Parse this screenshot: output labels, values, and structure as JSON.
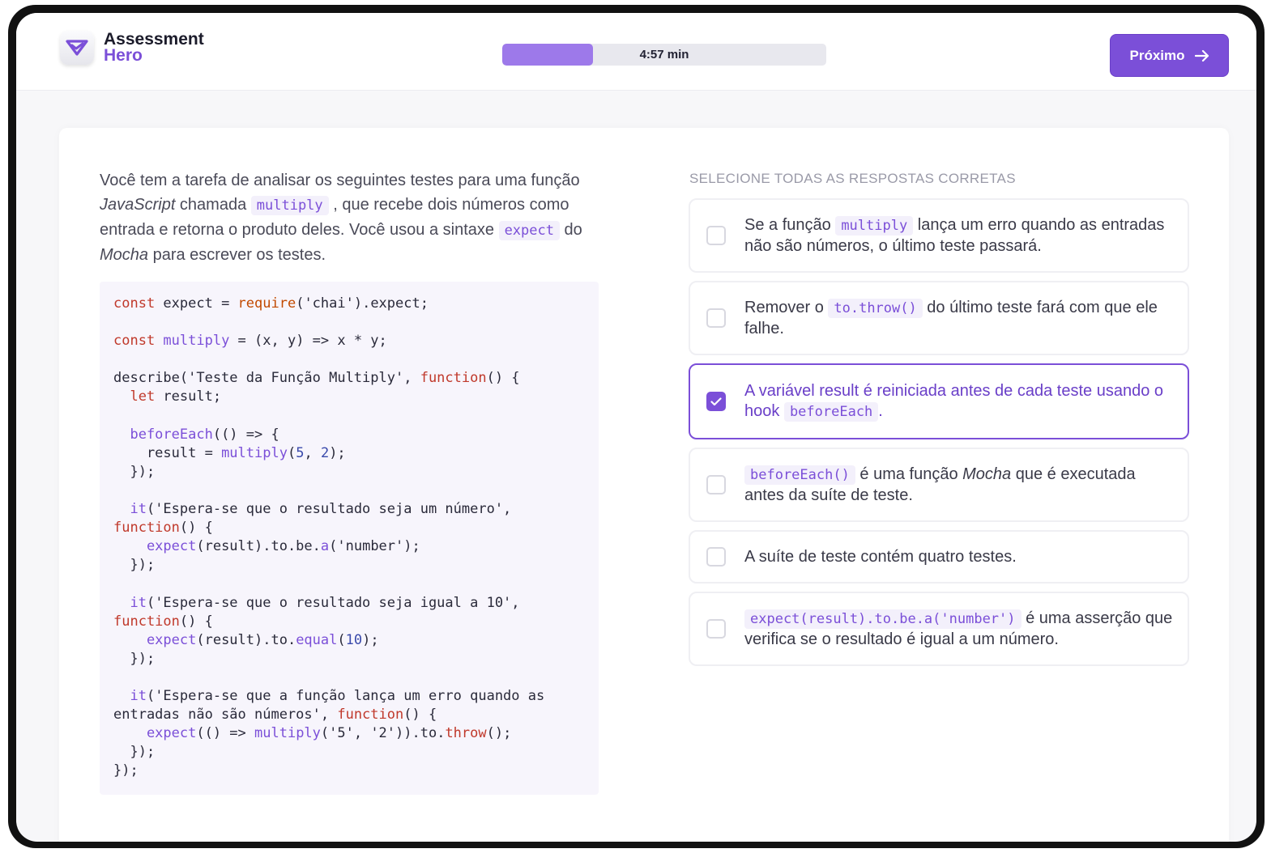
{
  "brand": {
    "line1": "Assessment",
    "line2": "Hero",
    "accent": "#7b4fd8"
  },
  "timer": {
    "label": "4:57 min",
    "progress_fraction": 0.28
  },
  "nav": {
    "next_label": "Próximo"
  },
  "question": {
    "p1": "Você tem a tarefa de analisar os seguintes testes para uma função ",
    "p2": "JavaScript",
    "p3": " chamada ",
    "p4": "multiply",
    "p5": " , que recebe dois números como entrada e retorna o produto deles. Você usou a sintaxe ",
    "p6": "expect",
    "p7": " do ",
    "p8": "Mocha",
    "p9": " para escrever os testes."
  },
  "code": {
    "l1_kw": "const",
    "l1_a": " expect = ",
    "l1_fn": "require",
    "l1_b": "('chai').expect;",
    "l2_kw": "const",
    "l2_fn": " multiply",
    "l2_b": " = (x, y) => x * y;",
    "l3_a": "describe('Teste da Função Multiply', ",
    "l3_kw": "function",
    "l3_b": "() {",
    "l4_kw": "  let",
    "l4_b": " result;",
    "l5_fn": "  beforeEach",
    "l5_b": "(() => {",
    "l6_a": "    result = ",
    "l6_fn": "multiply",
    "l6_b": "(",
    "l6_n1": "5",
    "l6_c": ", ",
    "l6_n2": "2",
    "l6_d": ");",
    "l7": "  });",
    "l8_fn": "  it",
    "l8_b": "('Espera-se que o resultado seja um número',",
    "l9_kw": "function",
    "l9_b": "() {",
    "l10_fn": "    expect",
    "l10_b": "(result).to.be.",
    "l10_fn2": "a",
    "l10_c": "('number');",
    "l11": "  });",
    "l12_fn": "  it",
    "l12_b": "('Espera-se que o resultado seja igual a 10',",
    "l13_kw": "function",
    "l13_b": "() {",
    "l14_fn": "    expect",
    "l14_b": "(result).to.",
    "l14_fn2": "equal",
    "l14_c": "(",
    "l14_n": "10",
    "l14_d": ");",
    "l15": "  });",
    "l16_fn": "  it",
    "l16_b": "('Espera-se que a função lança um erro quando as",
    "l17_a": "entradas não são números', ",
    "l17_kw": "function",
    "l17_b": "() {",
    "l18_fn": "    expect",
    "l18_b": "(() => ",
    "l18_fn2": "multiply",
    "l18_c": "('5', '2')).to.",
    "l18_kw": "throw",
    "l18_d": "();",
    "l19": "  });",
    "l20": "});"
  },
  "options_heading": "SELECIONE TODAS AS RESPOSTAS CORRETAS",
  "options": [
    {
      "a": "Se a função ",
      "code": "multiply",
      "b": " lança um erro quando as entradas não são números, o último teste passará.",
      "checked": false
    },
    {
      "a": "Remover o ",
      "code": "to.throw()",
      "b": " do último teste fará com que ele falhe.",
      "checked": false
    },
    {
      "a": "A variável result é reiniciada antes de cada teste usando o hook ",
      "code": "beforeEach",
      "b": ".",
      "checked": true
    },
    {
      "code": "beforeEach()",
      "a": " é uma função ",
      "em": "Mocha",
      "b": " que é executada antes da suíte de teste.",
      "checked": false
    },
    {
      "a": "A suíte de teste contém quatro testes.",
      "checked": false
    },
    {
      "code": "expect(result).to.be.a('number')",
      "b": " é uma asserção que verifica se o resultado é igual a um número.",
      "checked": false
    }
  ]
}
